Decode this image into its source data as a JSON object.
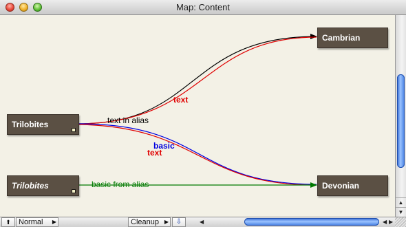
{
  "window": {
    "title": "Map: Content"
  },
  "notes": {
    "cambrian": {
      "label": "Cambrian"
    },
    "trilobites": {
      "label": "Trilobites"
    },
    "trilobites_alias": {
      "label": "Trilobites"
    },
    "devonian": {
      "label": "Devonian"
    }
  },
  "links": {
    "text_upper": "text",
    "text_in_alias": "text in alias",
    "basic": "basic",
    "text_lower": "text",
    "basic_from_alias": "basic from alias"
  },
  "colors": {
    "black_link": "#000000",
    "red_link": "#e00000",
    "blue_link": "#0000e0",
    "green_link": "#007a00",
    "note_fill": "#5b5044",
    "canvas": "#f3f1e6"
  },
  "statusbar": {
    "home_icon": "up-arrow-icon",
    "view_mode": "Normal",
    "cleanup_label": "Cleanup",
    "pin_icon": "pushpin-icon"
  }
}
